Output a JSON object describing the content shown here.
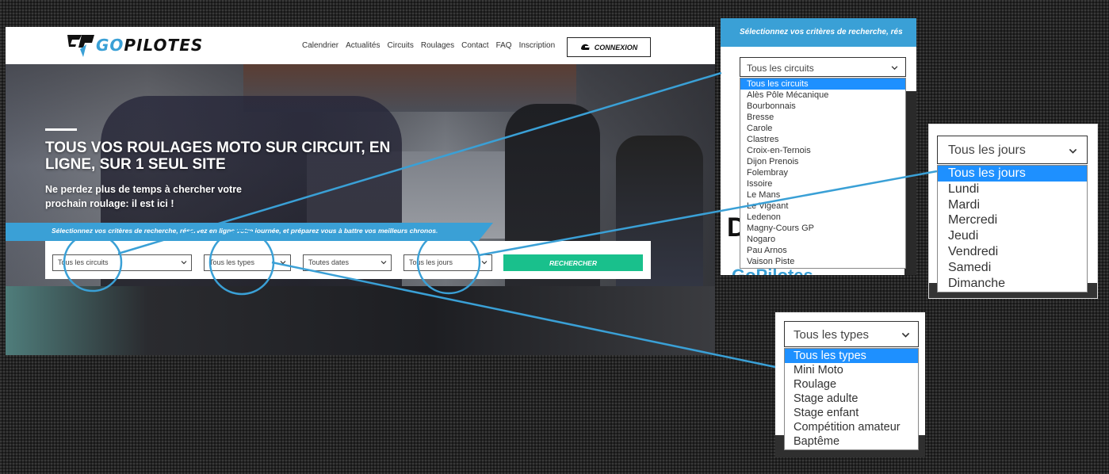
{
  "site": {
    "logo_brand": "GOPILOTES",
    "nav": [
      "Calendrier",
      "Actualités",
      "Circuits",
      "Roulages",
      "Contact",
      "FAQ",
      "Inscription"
    ],
    "connexion_label": "CONNEXION",
    "hero_title": "TOUS VOS ROULAGES MOTO SUR CIRCUIT, EN LIGNE, SUR 1 SEUL SITE",
    "hero_subtitle": "Ne perdez plus de temps à chercher votre prochain roulage: il est ici !",
    "search_prompt": "Sélectionnez vos critères de recherche, réservez en ligne votre journée, et préparez vous à battre vos meilleurs chronos.",
    "filters": {
      "circuits": "Tous les circuits",
      "types": "Tous les types",
      "dates": "Toutes dates",
      "jours": "Tous les jours"
    },
    "search_button": "RECHERCHER"
  },
  "circuits_dropdown": {
    "header_text": "Sélectionnez vos critères de recherche, rés",
    "selected": "Tous les circuits",
    "options": [
      "Tous les circuits",
      "Alès Pôle Mécanique",
      "Bourbonnais",
      "Bresse",
      "Carole",
      "Clastres",
      "Croix-en-Ternois",
      "Dijon Prenois",
      "Folembray",
      "Issoire",
      "Le Mans",
      "Le Vigeant",
      "Ledenon",
      "Magny-Cours GP",
      "Nogaro",
      "Pau Arnos",
      "Vaison Piste"
    ],
    "background_text_1": "D",
    "background_text_2": "GoPilotes"
  },
  "jours_dropdown": {
    "selected": "Tous les jours",
    "options": [
      "Tous les jours",
      "Lundi",
      "Mardi",
      "Mercredi",
      "Jeudi",
      "Vendredi",
      "Samedi",
      "Dimanche"
    ]
  },
  "types_dropdown": {
    "selected": "Tous les types",
    "options": [
      "Tous les types",
      "Mini Moto",
      "Roulage",
      "Stage adulte",
      "Stage enfant",
      "Compétition amateur",
      "Baptême"
    ]
  },
  "colors": {
    "brand_blue": "#3aa0d6",
    "search_green": "#19c08c",
    "selected_option": "#1e90ff",
    "callout": "#3aa0d6"
  },
  "icons": [
    "gopilotes-logo-icon",
    "helmet-icon",
    "chevron-down-icon"
  ]
}
